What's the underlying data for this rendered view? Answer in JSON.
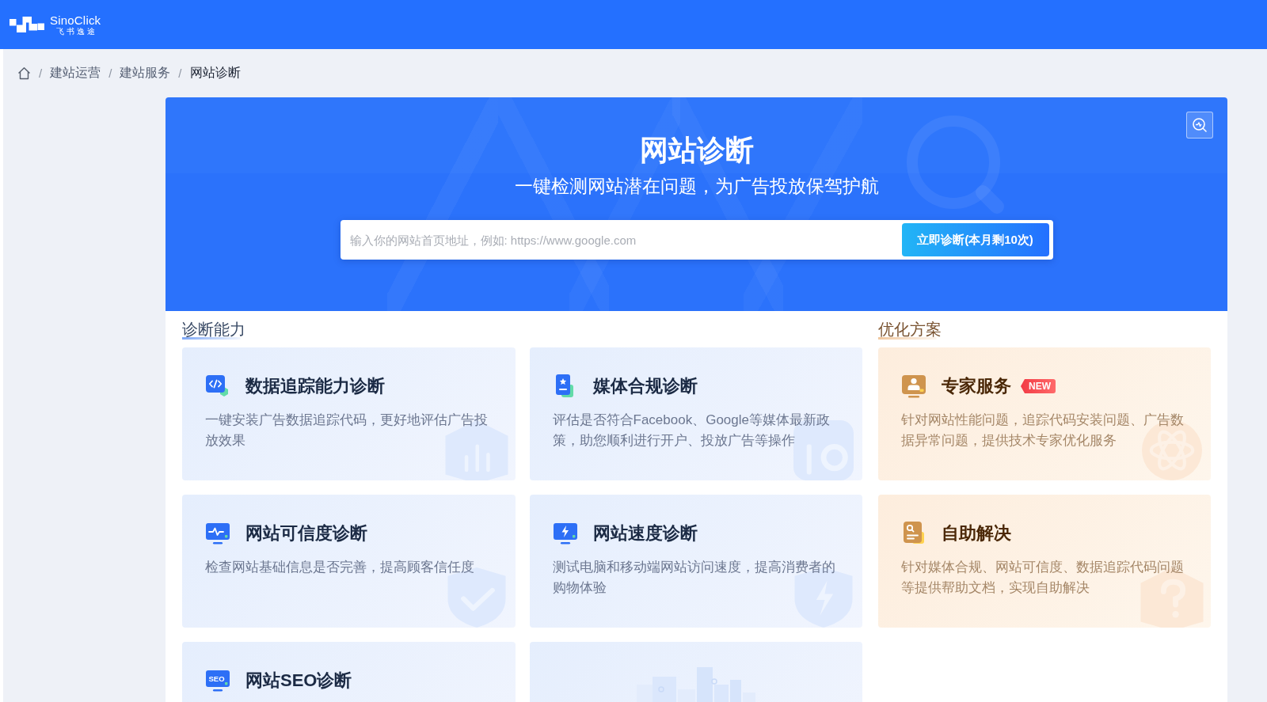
{
  "header": {
    "logo": {
      "name": "SinoClick",
      "tagline": "飞书逸途"
    }
  },
  "breadcrumb": {
    "separator": "/",
    "items": [
      {
        "label": "建站运营",
        "current": false
      },
      {
        "label": "建站服务",
        "current": false
      },
      {
        "label": "网站诊断",
        "current": true
      }
    ]
  },
  "hero": {
    "title": "网站诊断",
    "subtitle": "一键检测网站潜在问题，为广告投放保驾护航",
    "search": {
      "placeholder": "输入你的网站首页地址，例如: https://www.google.com"
    },
    "button": "立即诊断(本月剩10次)"
  },
  "sections": [
    {
      "kind": "diagnosis",
      "title": "诊断能力",
      "cards": [
        {
          "kind": "code",
          "title": "数据追踪能力诊断",
          "description": "一键安装广告数据追踪代码，更好地评估广告投放效果"
        },
        {
          "kind": "media",
          "title": "媒体合规诊断",
          "description": "评估是否符合Facebook、Google等媒体最新政策，助您顺利进行开户、投放广告等操作"
        },
        {
          "kind": "credibility",
          "title": "网站可信度诊断",
          "description": "检查网站基础信息是否完善，提高顾客信任度"
        },
        {
          "kind": "speed",
          "title": "网站速度诊断",
          "description": "测试电脑和移动端网站访问速度，提高消费者的购物体验"
        },
        {
          "kind": "seo",
          "icon_label": "SEO",
          "title": "网站SEO诊断"
        },
        {
          "kind": "illustration"
        }
      ]
    },
    {
      "kind": "solution",
      "title": "优化方案",
      "cards": [
        {
          "kind": "expert",
          "title": "专家服务",
          "badge": "NEW",
          "description": "针对网站性能问题，追踪代码安装问题、广告数据异常问题，提供技术专家优化服务"
        },
        {
          "kind": "selfhelp",
          "title": "自助解决",
          "description": "针对媒体合规、网站可信度、数据追踪代码问题等提供帮助文档，实现自助解决"
        }
      ]
    }
  ]
}
